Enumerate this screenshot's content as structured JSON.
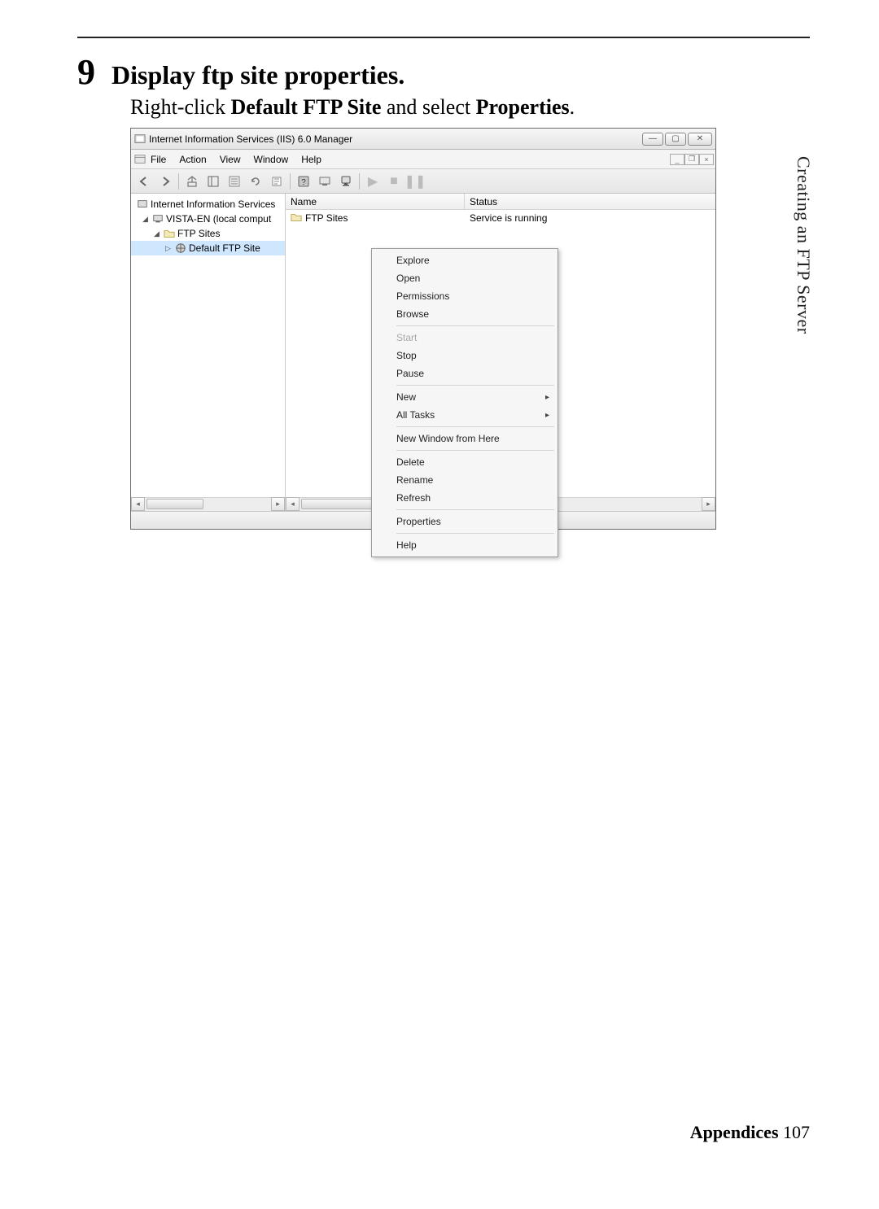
{
  "step": {
    "number": "9",
    "title": "Display ftp site properties.",
    "desc_prefix": "Right-click ",
    "desc_bold1": "Default FTP Site",
    "desc_mid": " and select ",
    "desc_bold2": "Properties",
    "desc_suffix": "."
  },
  "window": {
    "title": "Internet Information Services (IIS) 6.0 Manager",
    "menus": [
      "File",
      "Action",
      "View",
      "Window",
      "Help"
    ],
    "tree": {
      "root": "Internet Information Services",
      "computer": "VISTA-EN (local comput",
      "ftp_sites": "FTP Sites",
      "default_site": "Default FTP Site"
    },
    "columns": {
      "name": "Name",
      "status": "Status"
    },
    "rows": [
      {
        "name": "FTP Sites",
        "status": "Service is running"
      }
    ]
  },
  "context_menu": {
    "items": [
      {
        "label": "Explore"
      },
      {
        "label": "Open"
      },
      {
        "label": "Permissions"
      },
      {
        "label": "Browse"
      },
      {
        "sep": true
      },
      {
        "label": "Start",
        "disabled": true
      },
      {
        "label": "Stop"
      },
      {
        "label": "Pause"
      },
      {
        "sep": true
      },
      {
        "label": "New",
        "submenu": true
      },
      {
        "label": "All Tasks",
        "submenu": true
      },
      {
        "sep": true
      },
      {
        "label": "New Window from Here"
      },
      {
        "sep": true
      },
      {
        "label": "Delete"
      },
      {
        "label": "Rename"
      },
      {
        "label": "Refresh"
      },
      {
        "sep": true
      },
      {
        "label": "Properties"
      },
      {
        "sep": true
      },
      {
        "label": "Help"
      }
    ]
  },
  "sidebar": "Creating an FTP Server",
  "footer": {
    "label": "Appendices",
    "page": "107"
  }
}
